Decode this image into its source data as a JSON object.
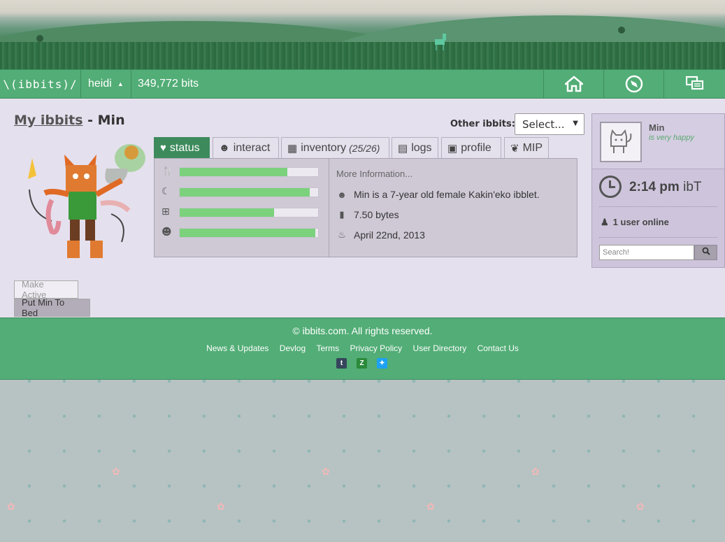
{
  "nav": {
    "logo": "\\(ibbits)/",
    "user": "heidi",
    "bits": "349,772 bits"
  },
  "page": {
    "title_link": "My ibbits",
    "title_suffix": " - Min",
    "other_label": "Other ibbits:",
    "other_select": "Select..."
  },
  "tabs": [
    {
      "label": "status",
      "icon": "heart-icon"
    },
    {
      "label": "interact",
      "icon": "pet-icon"
    },
    {
      "label": "inventory",
      "count": "(25/26)",
      "icon": "inventory-icon"
    },
    {
      "label": "logs",
      "icon": "logs-icon"
    },
    {
      "label": "profile",
      "icon": "profile-icon"
    },
    {
      "label": "MIP",
      "icon": "paw-icon"
    }
  ],
  "stats": [
    {
      "name": "hunger",
      "icon": "fork-knife-icon",
      "percent": 78
    },
    {
      "name": "energy",
      "icon": "moon-icon",
      "percent": 94
    },
    {
      "name": "health",
      "icon": "health-icon",
      "percent": 68
    },
    {
      "name": "happiness",
      "icon": "smile-icon",
      "percent": 98
    }
  ],
  "info": {
    "more": "More Information...",
    "description": "Min is a 7-year old female Kakin'eko ibblet.",
    "size": "7.50 bytes",
    "birthday": "April 22nd, 2013"
  },
  "buttons": {
    "make_active": "Make Active",
    "put_to_bed": "Put Min To Bed"
  },
  "sidebar": {
    "pet_name": "Min",
    "pet_mood": "is very happy",
    "time": "2:14 pm",
    "time_zone": "ibT",
    "online": "1 user online",
    "search_placeholder": "Search!"
  },
  "footer": {
    "copyright": "© ibbits.com. All rights reserved.",
    "links": [
      "News & Updates",
      "Devlog",
      "Terms",
      "Privacy Policy",
      "User Directory",
      "Contact Us"
    ]
  },
  "colors": {
    "nav_green": "#52ad76",
    "active_tab": "#3d8b5c",
    "bar_fill": "#7cd17d",
    "panel_bg": "#e5e0ee"
  }
}
